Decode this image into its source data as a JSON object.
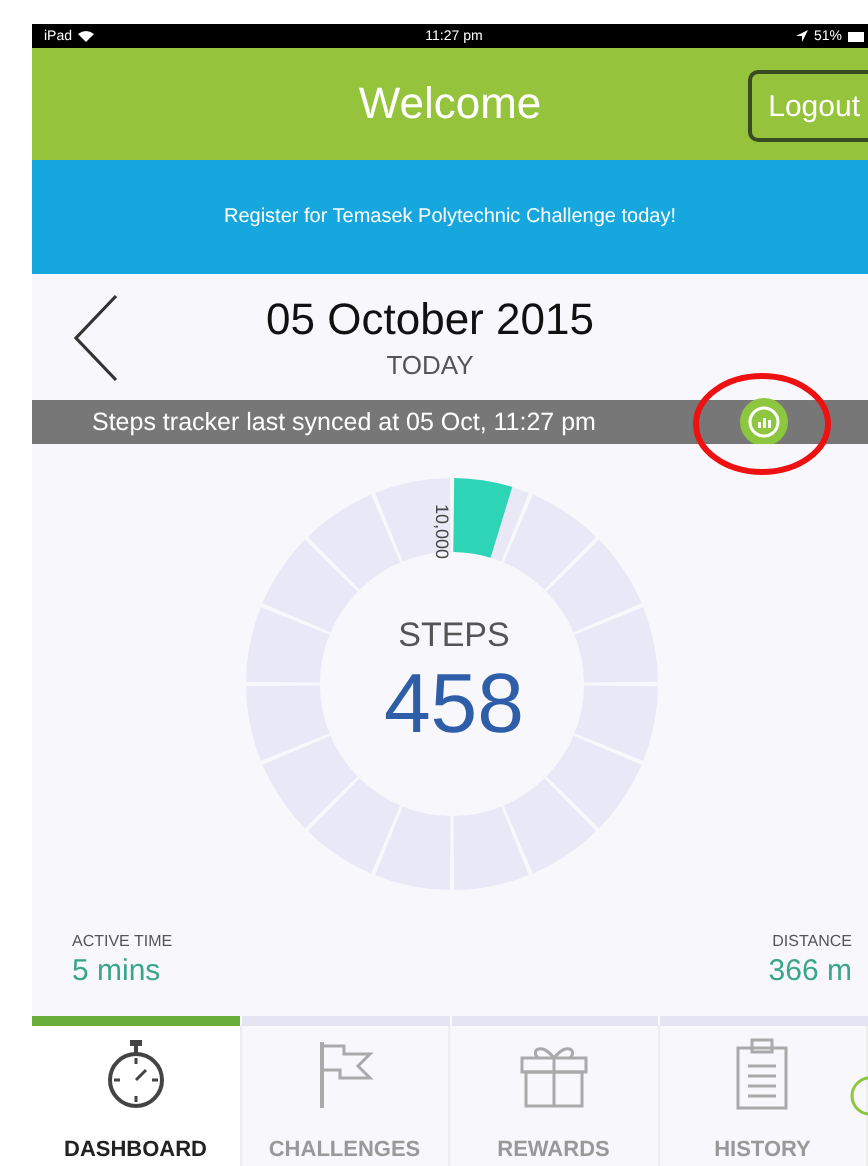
{
  "status_bar": {
    "device": "iPad",
    "time": "11:27 pm",
    "battery": "51%"
  },
  "header": {
    "title": "Welcome",
    "button": "Logout"
  },
  "banner": {
    "text": "Register for Temasek Polytechnic Challenge today!"
  },
  "date_nav": {
    "date": "05 October 2015",
    "subtitle": "TODAY"
  },
  "sync_bar": {
    "text": "Steps tracker last synced at 05 Oct, 11:27 pm"
  },
  "steps": {
    "goal": "10,000",
    "label": "STEPS",
    "value": "458"
  },
  "stats": [
    {
      "label": "ACTIVE TIME",
      "value": "5 mins"
    },
    {
      "label": "DISTANCE",
      "value": "366 m"
    }
  ],
  "tabs": [
    {
      "label": "DASHBOARD",
      "kind": "stopwatch",
      "selected": true
    },
    {
      "label": "CHALLENGES",
      "kind": "flag",
      "selected": false
    },
    {
      "label": "REWARDS",
      "kind": "gift",
      "selected": false
    },
    {
      "label": "HISTORY",
      "kind": "clipboard",
      "selected": false
    }
  ]
}
